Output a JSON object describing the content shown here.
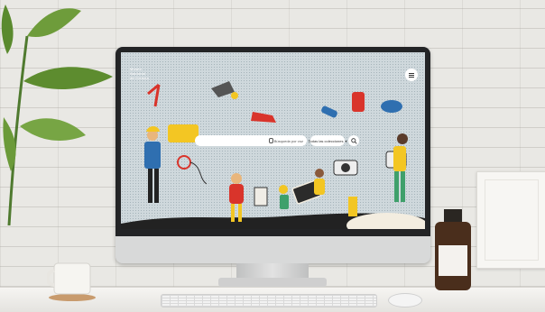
{
  "site": {
    "logo_line1": "Museo",
    "logo_line2": "Nacional",
    "logo_line3": "de Ciencia",
    "search": {
      "placeholder": "",
      "voice_label": "Búsqueda por voz",
      "category_label": "Todas las colecciones"
    }
  },
  "colors": {
    "screen_bg": "#cfd8dc",
    "accent_yellow": "#f3c623",
    "accent_red": "#d9342b",
    "accent_blue": "#2f6fb0",
    "accent_green": "#3fa06b"
  },
  "icons": {
    "menu": "hamburger-icon",
    "search": "magnifier-icon",
    "mic": "microphone-icon",
    "dropdown": "chevron-down-icon"
  }
}
